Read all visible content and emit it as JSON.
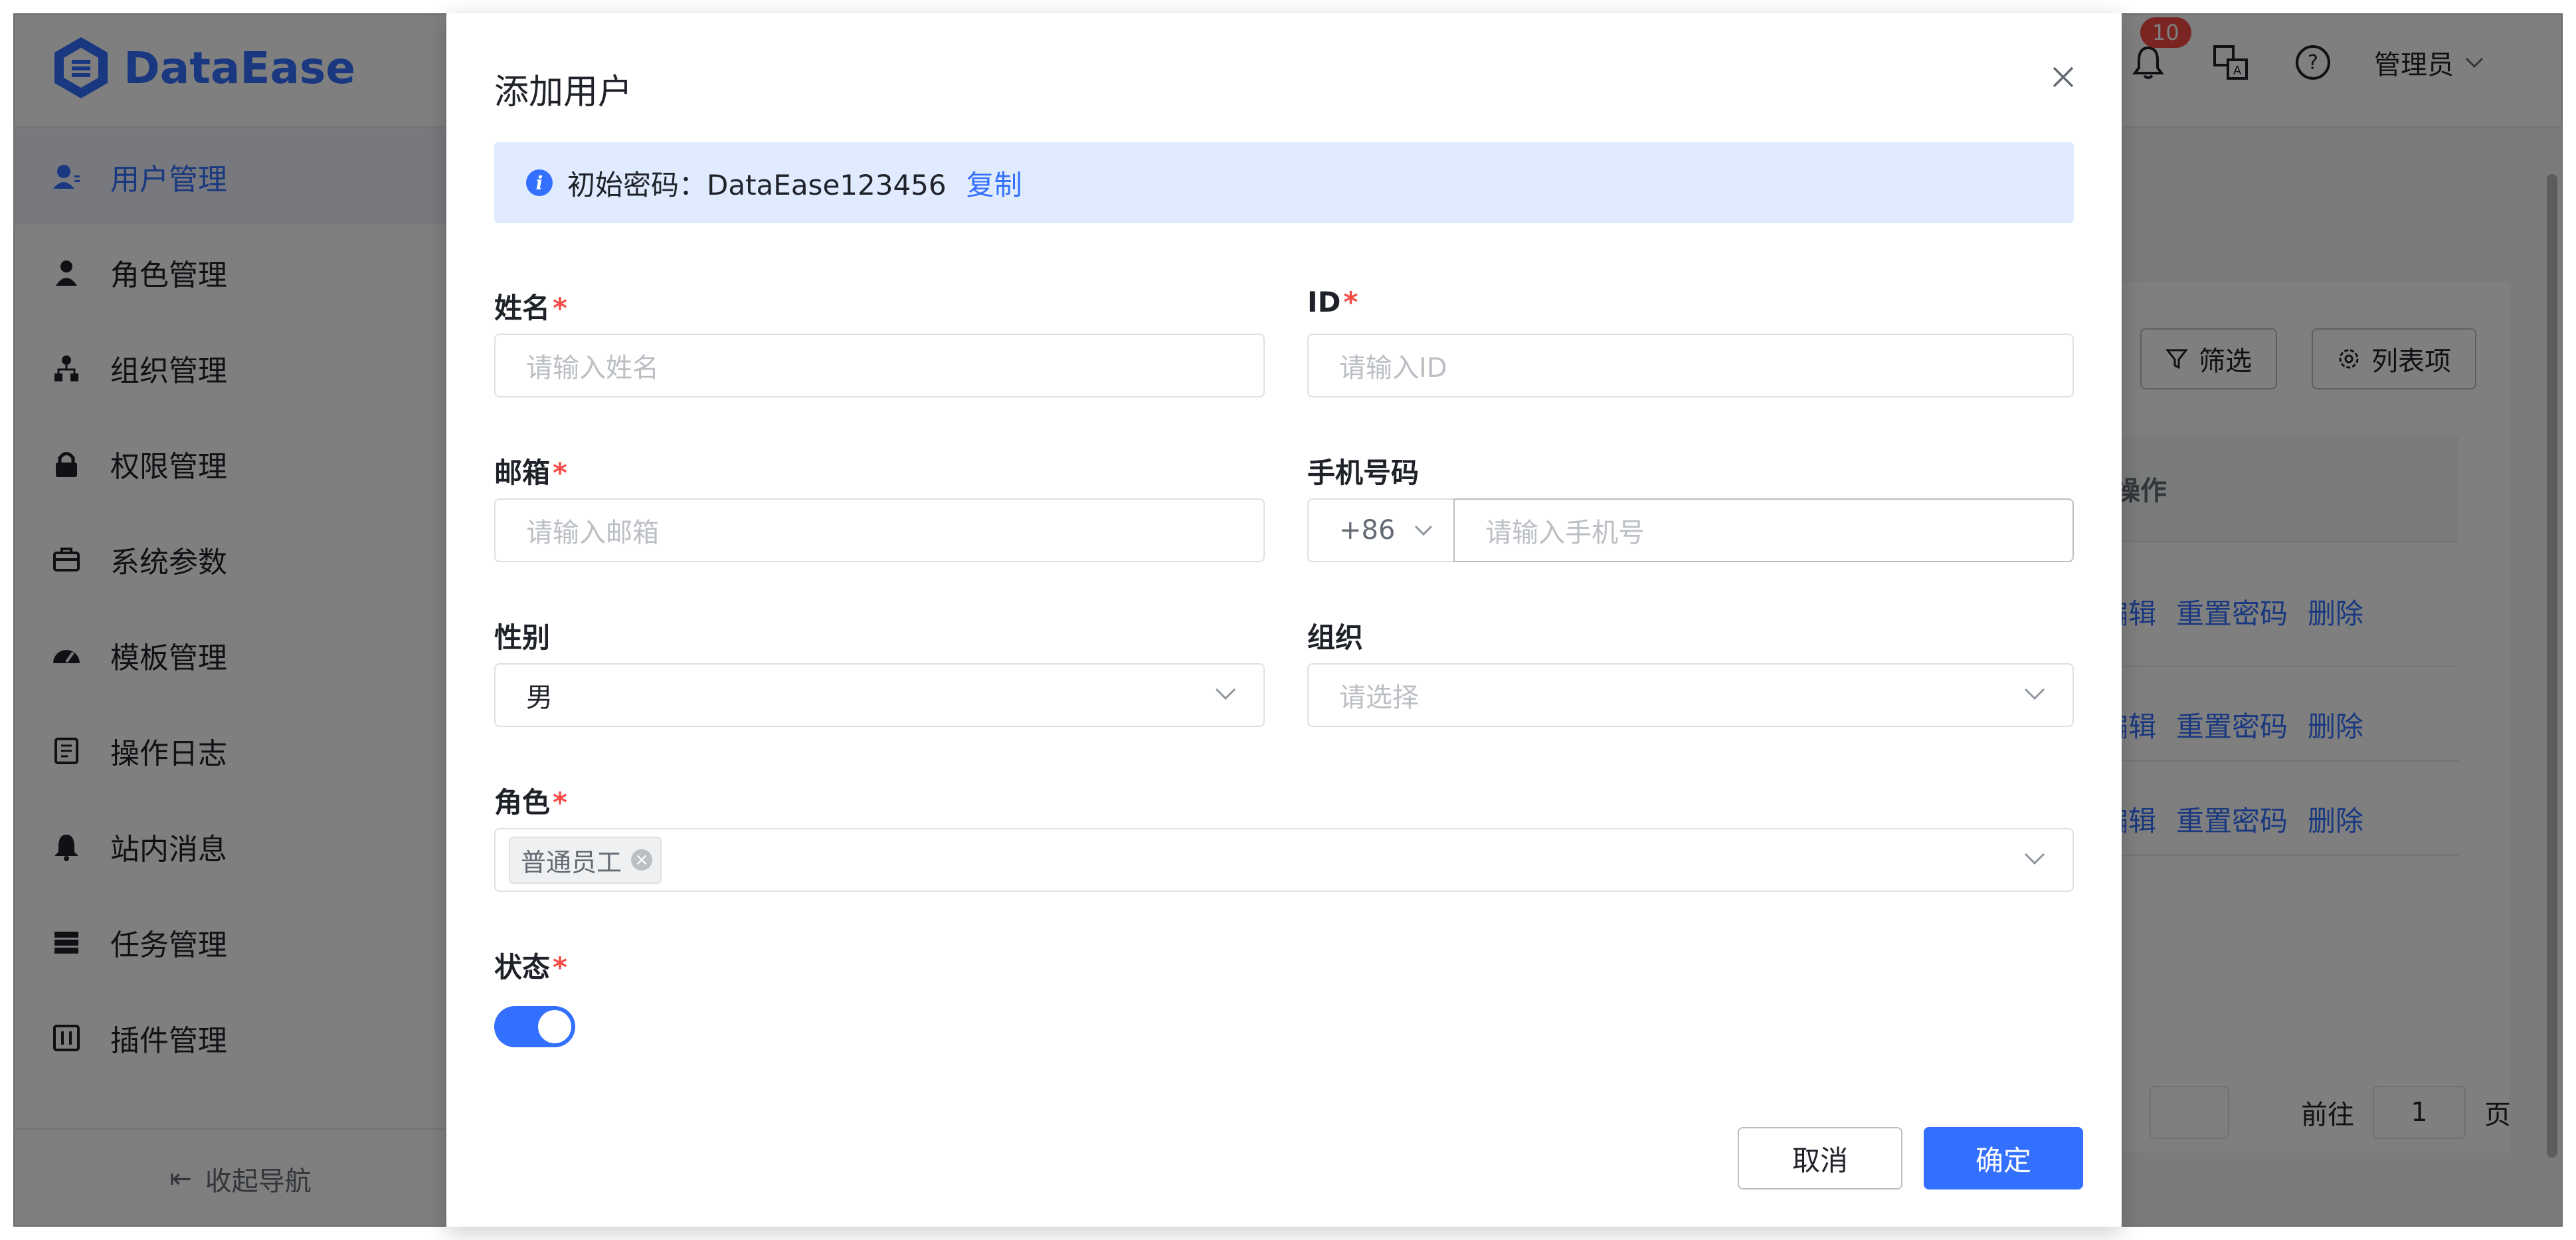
{
  "app": {
    "logo_text": "DataEase",
    "brand_color": "#3370ff",
    "notification_count": "10",
    "user_name": "管理员"
  },
  "sidebar": {
    "items": [
      {
        "label": "用户管理",
        "icon": "user-icon",
        "active": true
      },
      {
        "label": "角色管理",
        "icon": "role-icon"
      },
      {
        "label": "组织管理",
        "icon": "org-icon"
      },
      {
        "label": "权限管理",
        "icon": "lock-icon"
      },
      {
        "label": "系统参数",
        "icon": "toolbox-icon"
      },
      {
        "label": "模板管理",
        "icon": "dashboard-icon"
      },
      {
        "label": "操作日志",
        "icon": "log-icon"
      },
      {
        "label": "站内消息",
        "icon": "bell-icon"
      },
      {
        "label": "任务管理",
        "icon": "task-icon"
      },
      {
        "label": "插件管理",
        "icon": "plugin-icon"
      }
    ],
    "collapse_label": "收起导航"
  },
  "main": {
    "filter_label": "筛选",
    "columns_label": "列表项",
    "actions_header": "操作",
    "row_actions": {
      "edit": "编辑",
      "reset": "重置密码",
      "delete": "删除"
    },
    "pager": {
      "goto_label": "前往",
      "page_value": "1",
      "page_suffix": "页"
    }
  },
  "dialog": {
    "title": "添加用户",
    "alert": {
      "text": "初始密码：DataEase123456",
      "copy": "复制"
    },
    "fields": {
      "name": {
        "label": "姓名",
        "placeholder": "请输入姓名"
      },
      "id": {
        "label": "ID",
        "placeholder": "请输入ID"
      },
      "email": {
        "label": "邮箱",
        "placeholder": "请输入邮箱"
      },
      "phone": {
        "label": "手机号码",
        "prefix": "+86",
        "placeholder": "请输入手机号"
      },
      "gender": {
        "label": "性别",
        "value": "男"
      },
      "org": {
        "label": "组织",
        "placeholder": "请选择"
      },
      "role": {
        "label": "角色",
        "tag": "普通员工"
      },
      "status": {
        "label": "状态",
        "enabled": true
      }
    },
    "cancel_label": "取消",
    "ok_label": "确定"
  }
}
